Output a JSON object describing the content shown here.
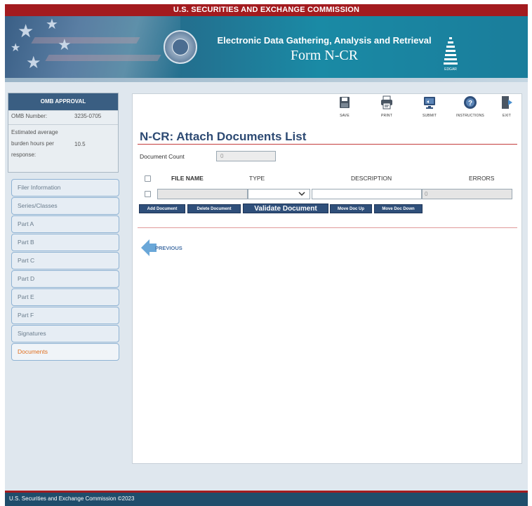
{
  "header": {
    "agency": "U.S. SECURITIES AND EXCHANGE COMMISSION",
    "system_title": "Electronic Data Gathering, Analysis and Retrieval",
    "form_title": "Form N-CR",
    "logo_text": "EDGAR"
  },
  "omb": {
    "title": "OMB APPROVAL",
    "number_label": "OMB Number:",
    "number_value": "3235-0705",
    "burden_label": "Estimated average burden hours per response:",
    "burden_value": "10.5"
  },
  "sidebar": {
    "items": [
      {
        "label": "Filer Information",
        "active": false
      },
      {
        "label": "Series/Classes",
        "active": false
      },
      {
        "label": "Part A",
        "active": false
      },
      {
        "label": "Part B",
        "active": false
      },
      {
        "label": "Part C",
        "active": false
      },
      {
        "label": "Part D",
        "active": false
      },
      {
        "label": "Part E",
        "active": false
      },
      {
        "label": "Part F",
        "active": false
      },
      {
        "label": "Signatures",
        "active": false
      },
      {
        "label": "Documents",
        "active": true
      }
    ]
  },
  "toolbar": {
    "save": "SAVE",
    "print": "PRINT",
    "submit": "SUBMIT",
    "instructions": "INSTRUCTIONS",
    "exit": "EXIT"
  },
  "main": {
    "page_title": "N-CR: Attach Documents List",
    "doc_count_label": "Document Count",
    "doc_count_value": "0",
    "columns": {
      "file_name": "FILE NAME",
      "type": "TYPE",
      "description": "DESCRIPTION",
      "errors": "ERRORS"
    },
    "row": {
      "file_name": "",
      "type": "",
      "description": "",
      "errors": "0"
    },
    "buttons": {
      "add": "Add Document",
      "delete": "Delete Document",
      "validate": "Validate Document",
      "move_up": "Move Doc Up",
      "move_down": "Move Doc Down"
    },
    "previous_label": "PREVIOUS"
  },
  "footer": {
    "text": "U.S. Securities and Exchange Commission ©2023"
  }
}
